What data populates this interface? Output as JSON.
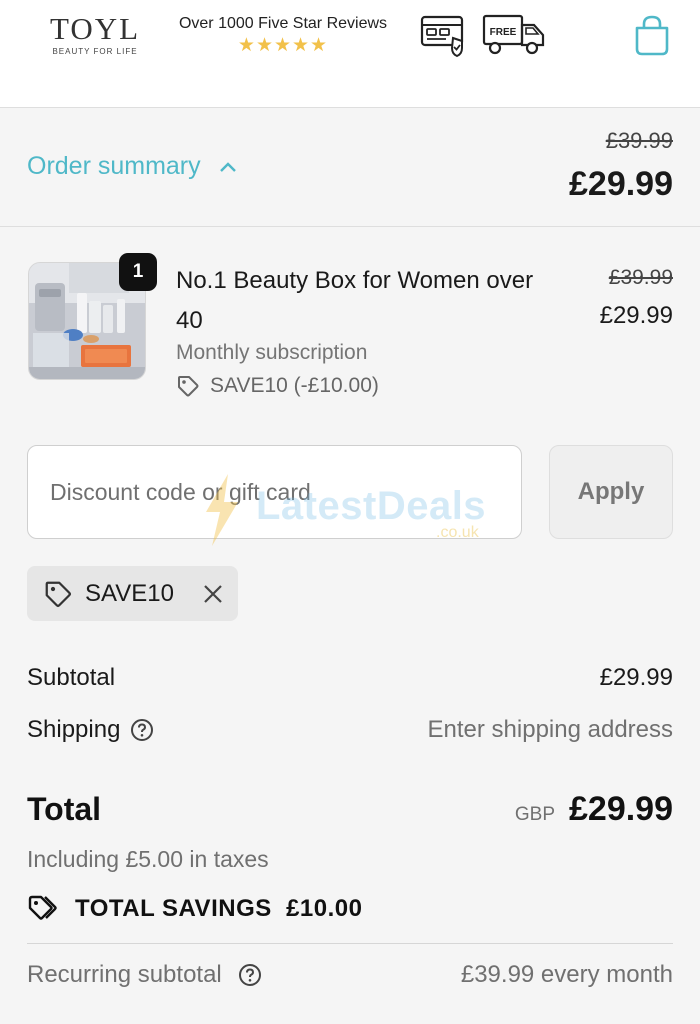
{
  "header": {
    "logo_main": "TOYL",
    "logo_sub": "BEAUTY FOR LIFE",
    "reviews_text": "Over 1000 Five Star Reviews",
    "stars": "★★★★★",
    "card_icon": "secure-card-icon",
    "truck_icon": "free-delivery-truck-icon",
    "truck_label": "FREE",
    "cart_icon": "shopping-bag-icon"
  },
  "summary": {
    "toggle_label": "Order summary",
    "original_price": "£39.99",
    "price": "£29.99"
  },
  "product": {
    "quantity": "1",
    "title": "No.1 Beauty Box for Women over 40",
    "subtitle": "Monthly subscription",
    "discount": "SAVE10 (-£10.00)",
    "original_price": "£39.99",
    "price": "£29.99"
  },
  "discount": {
    "placeholder": "Discount code or gift card",
    "apply_label": "Apply",
    "applied_code": "SAVE10"
  },
  "watermark": {
    "text": "LatestDeals",
    "sub": ".co.uk"
  },
  "totals": {
    "subtotal_label": "Subtotal",
    "subtotal_value": "£29.99",
    "shipping_label": "Shipping",
    "shipping_value": "Enter shipping address",
    "total_label": "Total",
    "currency": "GBP",
    "total_value": "£29.99",
    "taxes_text": "Including £5.00 in taxes",
    "savings_text": "TOTAL SAVINGS  £10.00",
    "recurring_label": "Recurring subtotal",
    "recurring_value": "£39.99 every month"
  },
  "colors": {
    "accent": "#4fb8c8",
    "stars": "#f2c14a"
  }
}
